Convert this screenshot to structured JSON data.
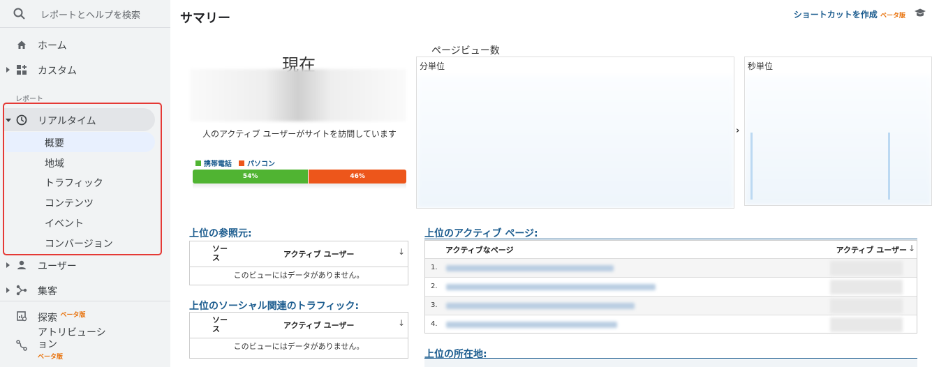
{
  "search": {
    "placeholder": "レポートとヘルプを検索",
    "icon": "search-icon"
  },
  "sidebar": {
    "home": "ホーム",
    "custom": "カスタム",
    "reports_section": "レポート",
    "realtime": "リアルタイム",
    "realtime_items": [
      "概要",
      "地域",
      "トラフィック",
      "コンテンツ",
      "イベント",
      "コンバージョン"
    ],
    "users": "ユーザー",
    "acquisition": "集客",
    "explore": "探索",
    "explore_badge": "ベータ版",
    "attribution": "アトリビューション",
    "attribution_badge": "ベータ版"
  },
  "header": {
    "title": "サマリー",
    "shortcut": "ショートカットを作成",
    "shortcut_badge": "ベータ版"
  },
  "now": {
    "title": "現在",
    "description": "人のアクティブ ユーザーがサイトを訪問しています",
    "legend_mobile": "携帯電話",
    "legend_desktop": "パソコン",
    "mobile_pct": "54%",
    "desktop_pct": "46%",
    "mobile_value": 54,
    "desktop_value": 46,
    "colors": {
      "mobile": "#50b432",
      "desktop": "#ed561b"
    }
  },
  "pageviews": {
    "title": "ページビュー数",
    "per_minute": "分単位",
    "per_second": "秒単位"
  },
  "referrers": {
    "title": "上位の参照元:",
    "col_source": "ソース",
    "col_users": "アクティブ ユーザー",
    "empty": "このビューにはデータがありません。"
  },
  "social": {
    "title": "上位のソーシャル関連のトラフィック:",
    "col_source": "ソース",
    "col_users": "アクティブ ユーザー",
    "empty": "このビューにはデータがありません。"
  },
  "active_pages": {
    "title": "上位のアクティブ ページ:",
    "col_page": "アクティブなページ",
    "col_users": "アクティブ ユーザー",
    "rows": [
      "1.",
      "2.",
      "3.",
      "4."
    ]
  },
  "locations": {
    "title": "上位の所在地:"
  },
  "colors": {
    "accent": "#1a5b8e",
    "highlight": "#e53935",
    "beta": "#e8710a"
  }
}
